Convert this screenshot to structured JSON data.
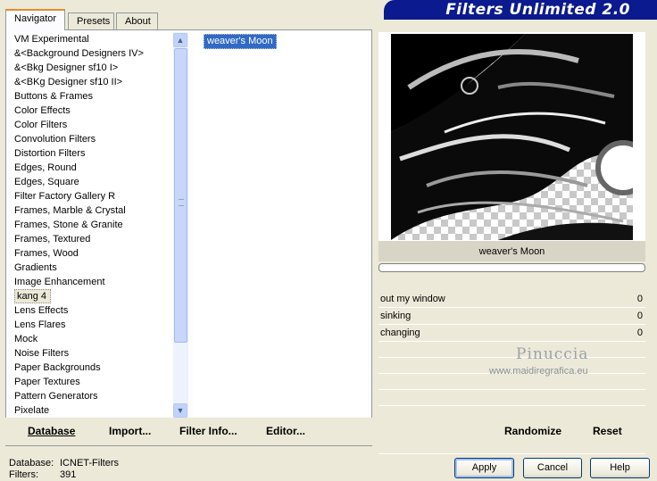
{
  "app": {
    "title": "Filters Unlimited 2.0"
  },
  "tabs": [
    {
      "label": "Navigator",
      "active": true
    },
    {
      "label": "Presets",
      "active": false
    },
    {
      "label": "About",
      "active": false
    }
  ],
  "categories": [
    "VM Experimental",
    "&<Background Designers IV>",
    "&<Bkg Designer sf10 I>",
    "&<BKg Designer sf10 II>",
    "Buttons & Frames",
    "Color Effects",
    "Color Filters",
    "Convolution Filters",
    "Distortion Filters",
    "Edges, Round",
    "Edges, Square",
    "Filter Factory Gallery R",
    "Frames, Marble & Crystal",
    "Frames, Stone & Granite",
    "Frames, Textured",
    "Frames, Wood",
    "Gradients",
    "Image Enhancement",
    "kang 4",
    "Lens Effects",
    "Lens Flares",
    "Mock",
    "Noise Filters",
    "Paper Backgrounds",
    "Paper Textures",
    "Pattern Generators",
    "Pixelate"
  ],
  "selected_category": "kang 4",
  "filters": [
    "weaver's Moon"
  ],
  "selected_filter": "weaver's Moon",
  "left_buttons": {
    "database": "Database",
    "import": "Import...",
    "filter_info": "Filter Info...",
    "editor": "Editor..."
  },
  "preview": {
    "filter_name": "weaver's Moon"
  },
  "params": [
    {
      "label": "out my window",
      "value": "0"
    },
    {
      "label": "sinking",
      "value": "0"
    },
    {
      "label": "changing",
      "value": "0"
    }
  ],
  "watermark": {
    "line1": "Pinuccia",
    "line2": "www.maidiregrafica.eu"
  },
  "right_buttons": {
    "randomize": "Randomize",
    "reset": "Reset"
  },
  "status": {
    "database_label": "Database:",
    "database_value": "ICNET-Filters",
    "filters_label": "Filters:",
    "filters_value": "391"
  },
  "dialog_buttons": {
    "apply": "Apply",
    "cancel": "Cancel",
    "help": "Help"
  }
}
